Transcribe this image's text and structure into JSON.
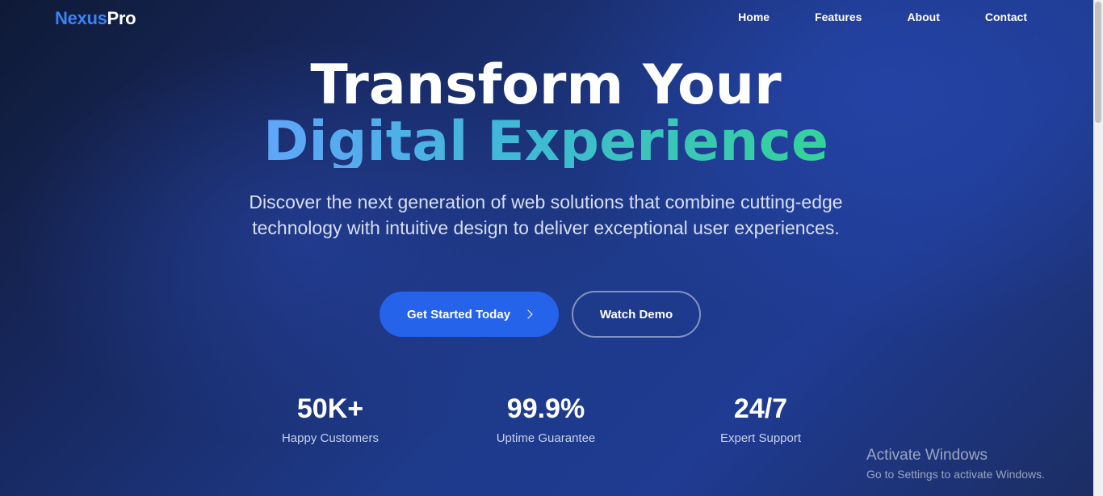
{
  "nav": {
    "logo_part1": "Nexus",
    "logo_part2": "Pro",
    "links": [
      "Home",
      "Features",
      "About",
      "Contact"
    ]
  },
  "hero": {
    "title_line1": "Transform Your",
    "title_line2": "Digital Experience",
    "subtitle": "Discover the next generation of web solutions that combine cutting-edge technology with intuitive design to deliver exceptional user experiences.",
    "primary_button": "Get Started Today",
    "primary_button_icon": "chevron-right-icon",
    "secondary_button": "Watch Demo"
  },
  "stats": [
    {
      "value": "50K+",
      "label": "Happy Customers"
    },
    {
      "value": "99.9%",
      "label": "Uptime Guarantee"
    },
    {
      "value": "24/7",
      "label": "Expert Support"
    }
  ],
  "watermark": {
    "title": "Activate Windows",
    "subtitle": "Go to Settings to activate Windows."
  },
  "colors": {
    "brand": "#3b82f6",
    "primary_button": "#2563eb",
    "gradient_start": "#60a5fa",
    "gradient_end": "#34d399"
  }
}
